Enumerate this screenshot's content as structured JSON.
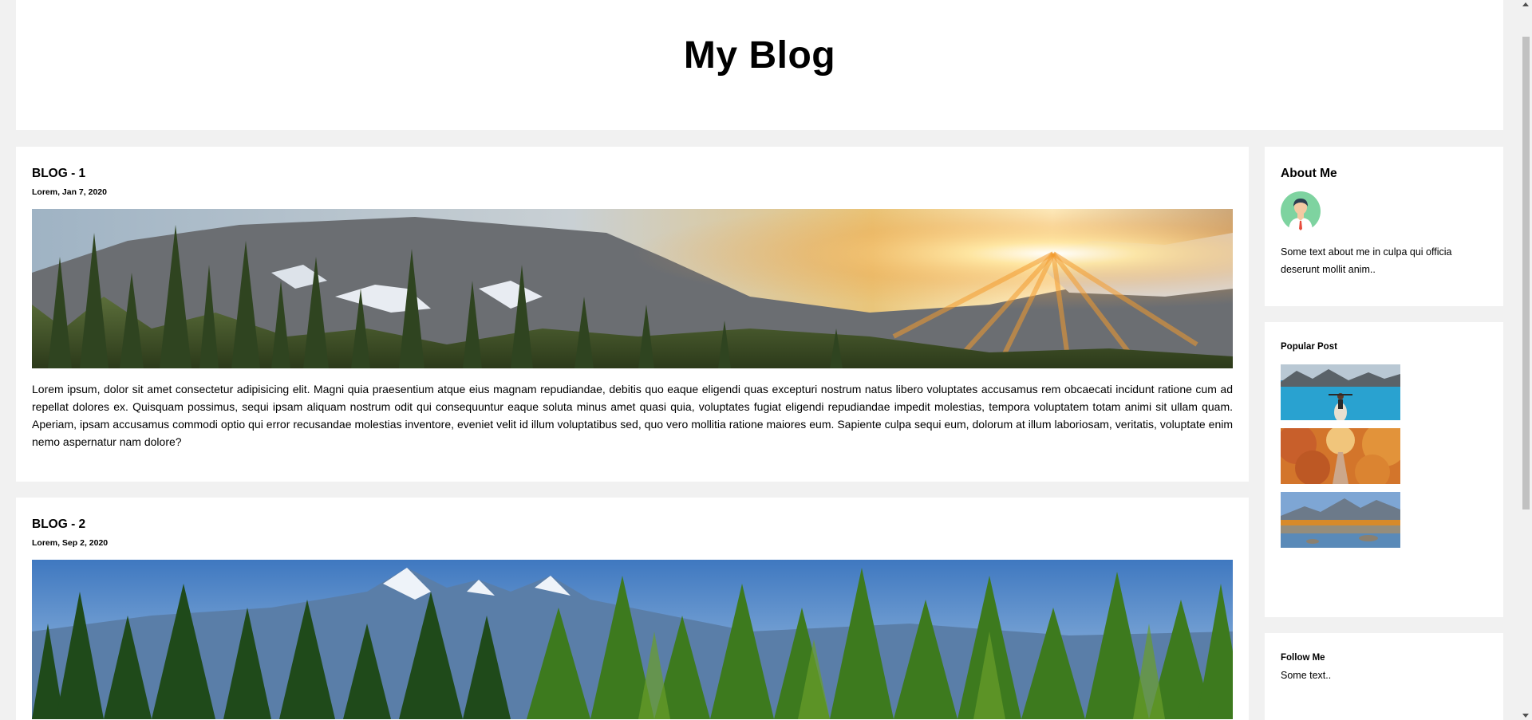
{
  "header": {
    "title": "My Blog"
  },
  "posts": [
    {
      "title": "BLOG - 1",
      "date": "Lorem, Jan 7, 2020",
      "image_alt": "mountain sunset forest",
      "body": "Lorem ipsum, dolor sit amet consectetur adipisicing elit. Magni quia praesentium atque eius magnam repudiandae, debitis quo eaque eligendi quas excepturi nostrum natus libero voluptates accusamus rem obcaecati incidunt ratione cum ad repellat dolores ex. Quisquam possimus, sequi ipsam aliquam nostrum odit qui consequuntur eaque soluta minus amet quasi quia, voluptates fugiat eligendi repudiandae impedit molestias, tempora voluptatem totam animi sit ullam quam. Aperiam, ipsam accusamus commodi optio qui error recusandae molestias inventore, eveniet velit id illum voluptatibus sed, quo vero mollitia ratione maiores eum. Sapiente culpa sequi eum, dolorum at illum laboriosam, veritatis, voluptate enim nemo aspernatur nam dolore?"
    },
    {
      "title": "BLOG - 2",
      "date": "Lorem, Sep 2, 2020",
      "image_alt": "snowy mountains pine forest"
    }
  ],
  "sidebar": {
    "about": {
      "title": "About Me",
      "avatar_icon": "avatar-icon",
      "text": "Some text about me in culpa qui officia deserunt mollit anim.."
    },
    "popular": {
      "title": "Popular Post",
      "thumbs": [
        "kayak-lake",
        "autumn-road",
        "mountain-lake"
      ]
    },
    "follow": {
      "title": "Follow Me",
      "text": "Some text.."
    }
  },
  "colors": {
    "page_bg": "#f1f1f1",
    "card_bg": "#ffffff",
    "avatar_bg": "#7ed3a0"
  }
}
